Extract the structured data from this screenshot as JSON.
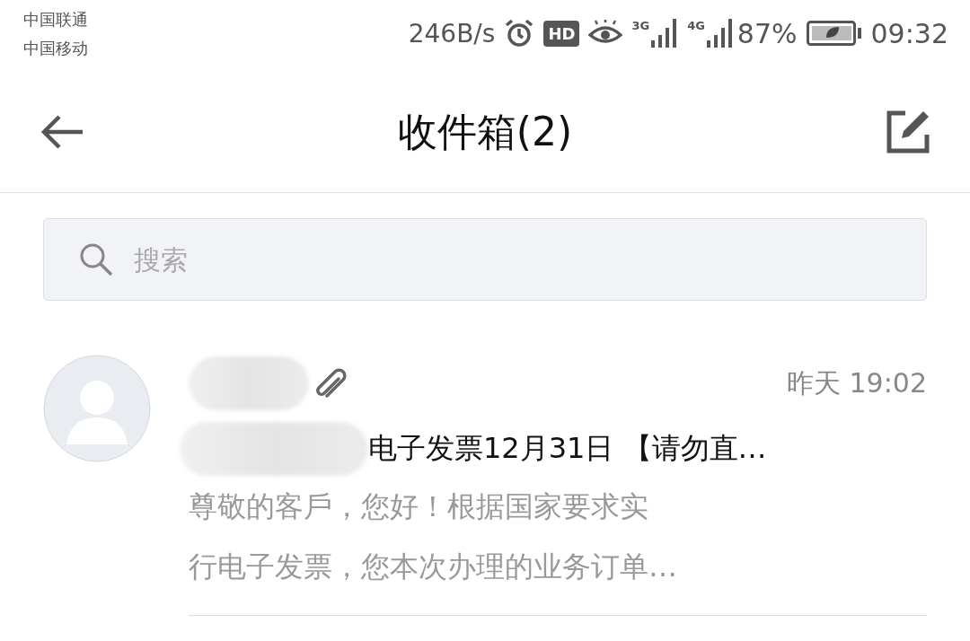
{
  "status_bar": {
    "carriers": [
      "中国联通",
      "中国移动"
    ],
    "speed": "246B/s",
    "hd": "HD",
    "net1": "3G",
    "net2": "4G",
    "battery": "87%",
    "time": "09:32"
  },
  "header": {
    "title": "收件箱(2)"
  },
  "search": {
    "placeholder": "搜索"
  },
  "messages": [
    {
      "has_attachment": true,
      "time": "昨天  19:02",
      "subject": "电子发票12月31日 【请勿直…",
      "preview_lines": [
        "尊敬的客戶，您好！根据国家要求实",
        "行电子发票，您本次办理的业务订单…"
      ]
    }
  ]
}
